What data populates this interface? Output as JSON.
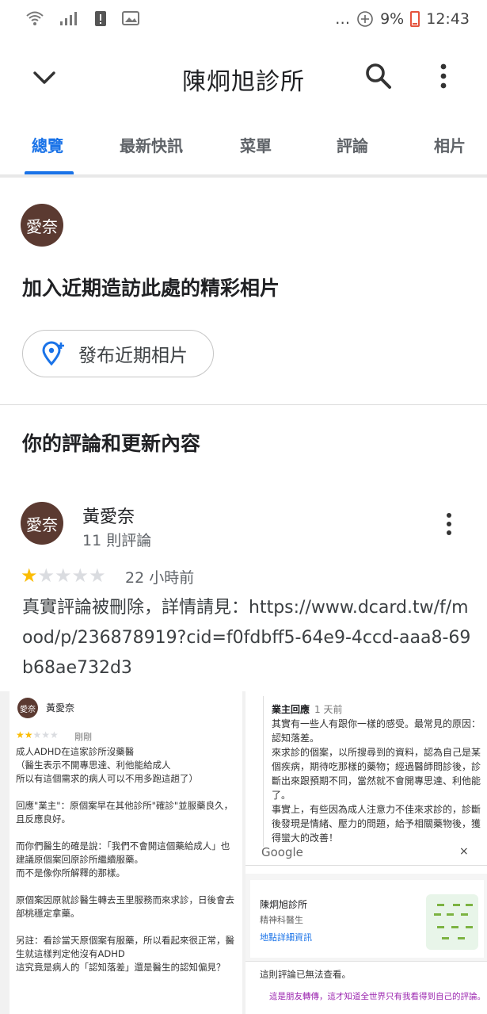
{
  "status_bar": {
    "battery": "9%",
    "time": "12:43",
    "dots": "…"
  },
  "app_bar": {
    "title": "陳炯旭診所"
  },
  "tabs": [
    {
      "label": "總覽",
      "active": true
    },
    {
      "label": "最新快訊",
      "active": false
    },
    {
      "label": "菜單",
      "active": false
    },
    {
      "label": "評論",
      "active": false
    },
    {
      "label": "相片",
      "active": false
    }
  ],
  "photo_section": {
    "avatar_text": "愛奈",
    "title": "加入近期造訪此處的精彩相片",
    "button_label": "發布近期相片"
  },
  "reviews_section": {
    "title": "你的評論和更新內容"
  },
  "review": {
    "avatar_text": "愛奈",
    "author": "黃愛奈",
    "count": "11 則評論",
    "rating": 1,
    "max_rating": 5,
    "time": "22 小時前",
    "text": "真實評論被刪除，詳情請見：https://www.dcard.tw/f/mood/p/236878919?cid=f0fdbff5-64e9-4ccd-aaa8-69b68ae732d3"
  },
  "embedded": {
    "left": {
      "avatar_text": "愛奈",
      "author": "黃愛奈",
      "rating": 2,
      "time": "剛剛",
      "body": "成人ADHD在這家診所沒藥醫\n（醫生表示不開專思達、利他能給成人\n所以有這個需求的病人可以不用多跑這趟了）\n\n回應\"業主\"：原個案早在其他診所\"確診\"並服藥良久，且反應良好。\n\n而你們醫生的確是說：「我們不會開這個藥給成人」也建議原個案回原診所繼續服藥。\n而不是像你所解釋的那樣。\n\n原個案因原就診醫生轉去玉里服務而來求診，日後會去部桃穩定拿藥。\n\n另註：看診當天原個案有服藥，所以看起來很正常，醫生就這樣判定他沒有ADHD\n這究竟是病人的「認知落差」還是醫生的認知偏見？"
    },
    "right": {
      "owner_label": "業主回應",
      "owner_time": "1 天前",
      "owner_body": "其實有一些人有跟你一樣的感受。最常見的原因：認知落差。\n來求診的個案，以所搜尋到的資料，認為自己是某個疾病，期待吃那樣的藥物；經過醫師問診後，診斷出來跟預期不同，當然就不會開專思達、利他能了。\n事實上，有些因為成人注意力不佳來求診的，診斷後發現是情緒、壓力的問題，給予相關藥物後，獲得蠻大的改善！",
      "google_text": "Google",
      "close": "×",
      "clinic_name": "陳炯旭診所",
      "clinic_type": "精神科醫生",
      "details_link": "地點詳細資訊",
      "notice": "這則評論已無法查看。",
      "notice_pink": "這是朋友轉傳，這才知道全世界只有我看得到自己的評論。"
    }
  },
  "colors": {
    "accent": "#1a73e8",
    "avatar_bg": "#5b3a31",
    "star": "#fbbc04"
  }
}
